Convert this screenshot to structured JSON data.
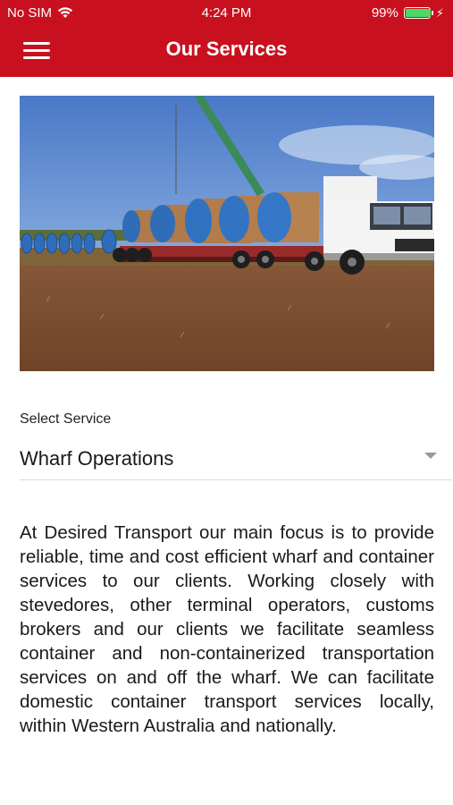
{
  "status_bar": {
    "carrier": "No SIM",
    "time": "4:24 PM",
    "battery_percent": "99%",
    "battery_level": 0.99
  },
  "header": {
    "title": "Our Services",
    "menu_icon": "hamburger-menu-icon",
    "background_color": "#c8101f"
  },
  "service_select": {
    "label": "Select Service",
    "selected": "Wharf Operations"
  },
  "description": "At Desired Transport our main focus is to provide reliable, time and cost efficient wharf and container services to our clients. Working closely with stevedores, other terminal operators, customs brokers and our clients we facilitate seamless container and non-containerized transportation services on and off the wharf. We can facilitate domestic container transport services locally, within Western Australia and nationally."
}
